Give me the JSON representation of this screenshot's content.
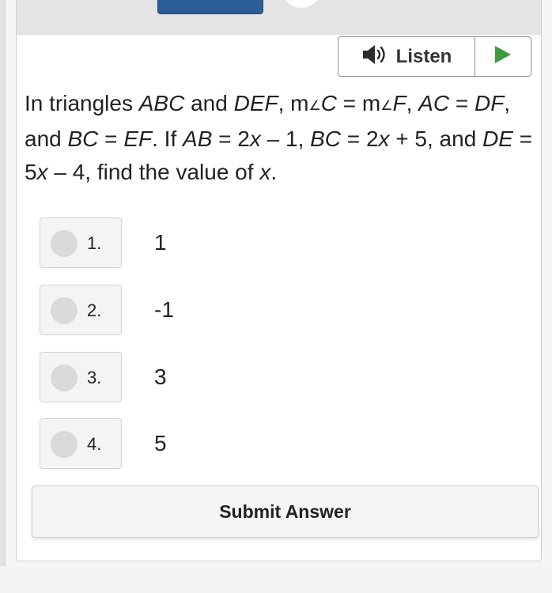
{
  "listen": {
    "label": "Listen"
  },
  "question": {
    "prefix": "In triangles ",
    "t1": "ABC",
    "and1": " and ",
    "t2": "DEF",
    "s1": ", m",
    "angle1": "∠",
    "v1": "C",
    "s2": " = m",
    "angle2": "∠",
    "v2": "F",
    "s3": ", ",
    "v3": "AC",
    "s4": " = ",
    "v4": "DF",
    "s5": ", and ",
    "v5": "BC",
    "s6": " = ",
    "v6": "EF",
    "s7": ". If ",
    "v7": "AB",
    "s8": " = 2",
    "v8": "x",
    "s9": " – 1, ",
    "v9": "BC",
    "s10": " = 2",
    "v10": "x",
    "s11": " + 5, and ",
    "v11": "DE",
    "s12": " = 5",
    "v12": "x",
    "s13": " – 4, find the value of ",
    "v13": "x",
    "s14": "."
  },
  "choices": [
    {
      "number": "1.",
      "value": "1"
    },
    {
      "number": "2.",
      "value": "-1"
    },
    {
      "number": "3.",
      "value": "3"
    },
    {
      "number": "4.",
      "value": "5"
    }
  ],
  "submit": {
    "label": "Submit Answer"
  },
  "colors": {
    "top_button": "#2d5d96",
    "play_icon": "#3d9a3d",
    "speaker_icon": "#2d2d2d"
  }
}
